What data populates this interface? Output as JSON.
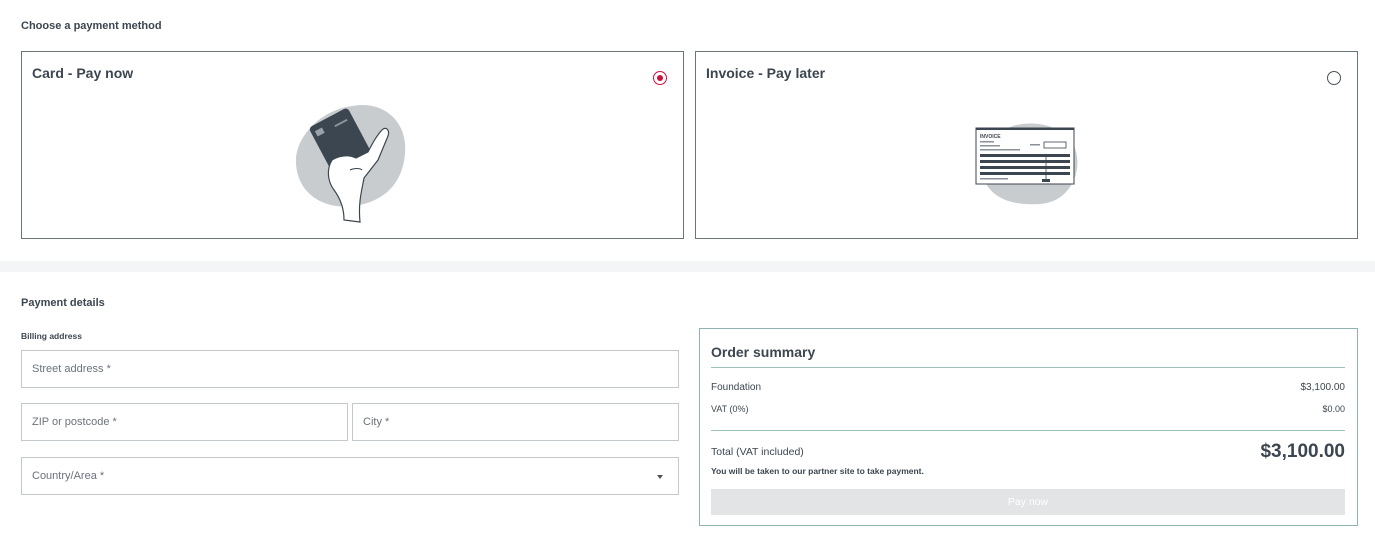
{
  "payment_method": {
    "heading": "Choose a payment method",
    "options": [
      {
        "label": "Card - Pay now",
        "selected": true,
        "icon": "card-hand-illustration"
      },
      {
        "label": "Invoice - Pay later",
        "selected": false,
        "icon": "invoice-illustration"
      }
    ],
    "invoice_doc_label": "INVOICE"
  },
  "payment_details": {
    "heading": "Payment details",
    "billing_label": "Billing address",
    "fields": {
      "street": {
        "placeholder": "Street address *",
        "value": ""
      },
      "zip": {
        "placeholder": "ZIP or postcode *",
        "value": ""
      },
      "city": {
        "placeholder": "City *",
        "value": ""
      },
      "country": {
        "placeholder": "Country/Area *",
        "value": ""
      }
    }
  },
  "order_summary": {
    "title": "Order summary",
    "lines": [
      {
        "label": "Foundation",
        "value": "$3,100.00"
      },
      {
        "label": "VAT (0%)",
        "value": "$0.00"
      }
    ],
    "total_label": "Total (VAT included)",
    "total_value": "$3,100.00",
    "note": "You will be taken to our partner site to take payment.",
    "pay_button": "Pay now",
    "pay_button_enabled": false
  },
  "colors": {
    "accent_radio": "#d0103a",
    "summary_border": "#8fb3b0",
    "text": "#3c4650"
  }
}
